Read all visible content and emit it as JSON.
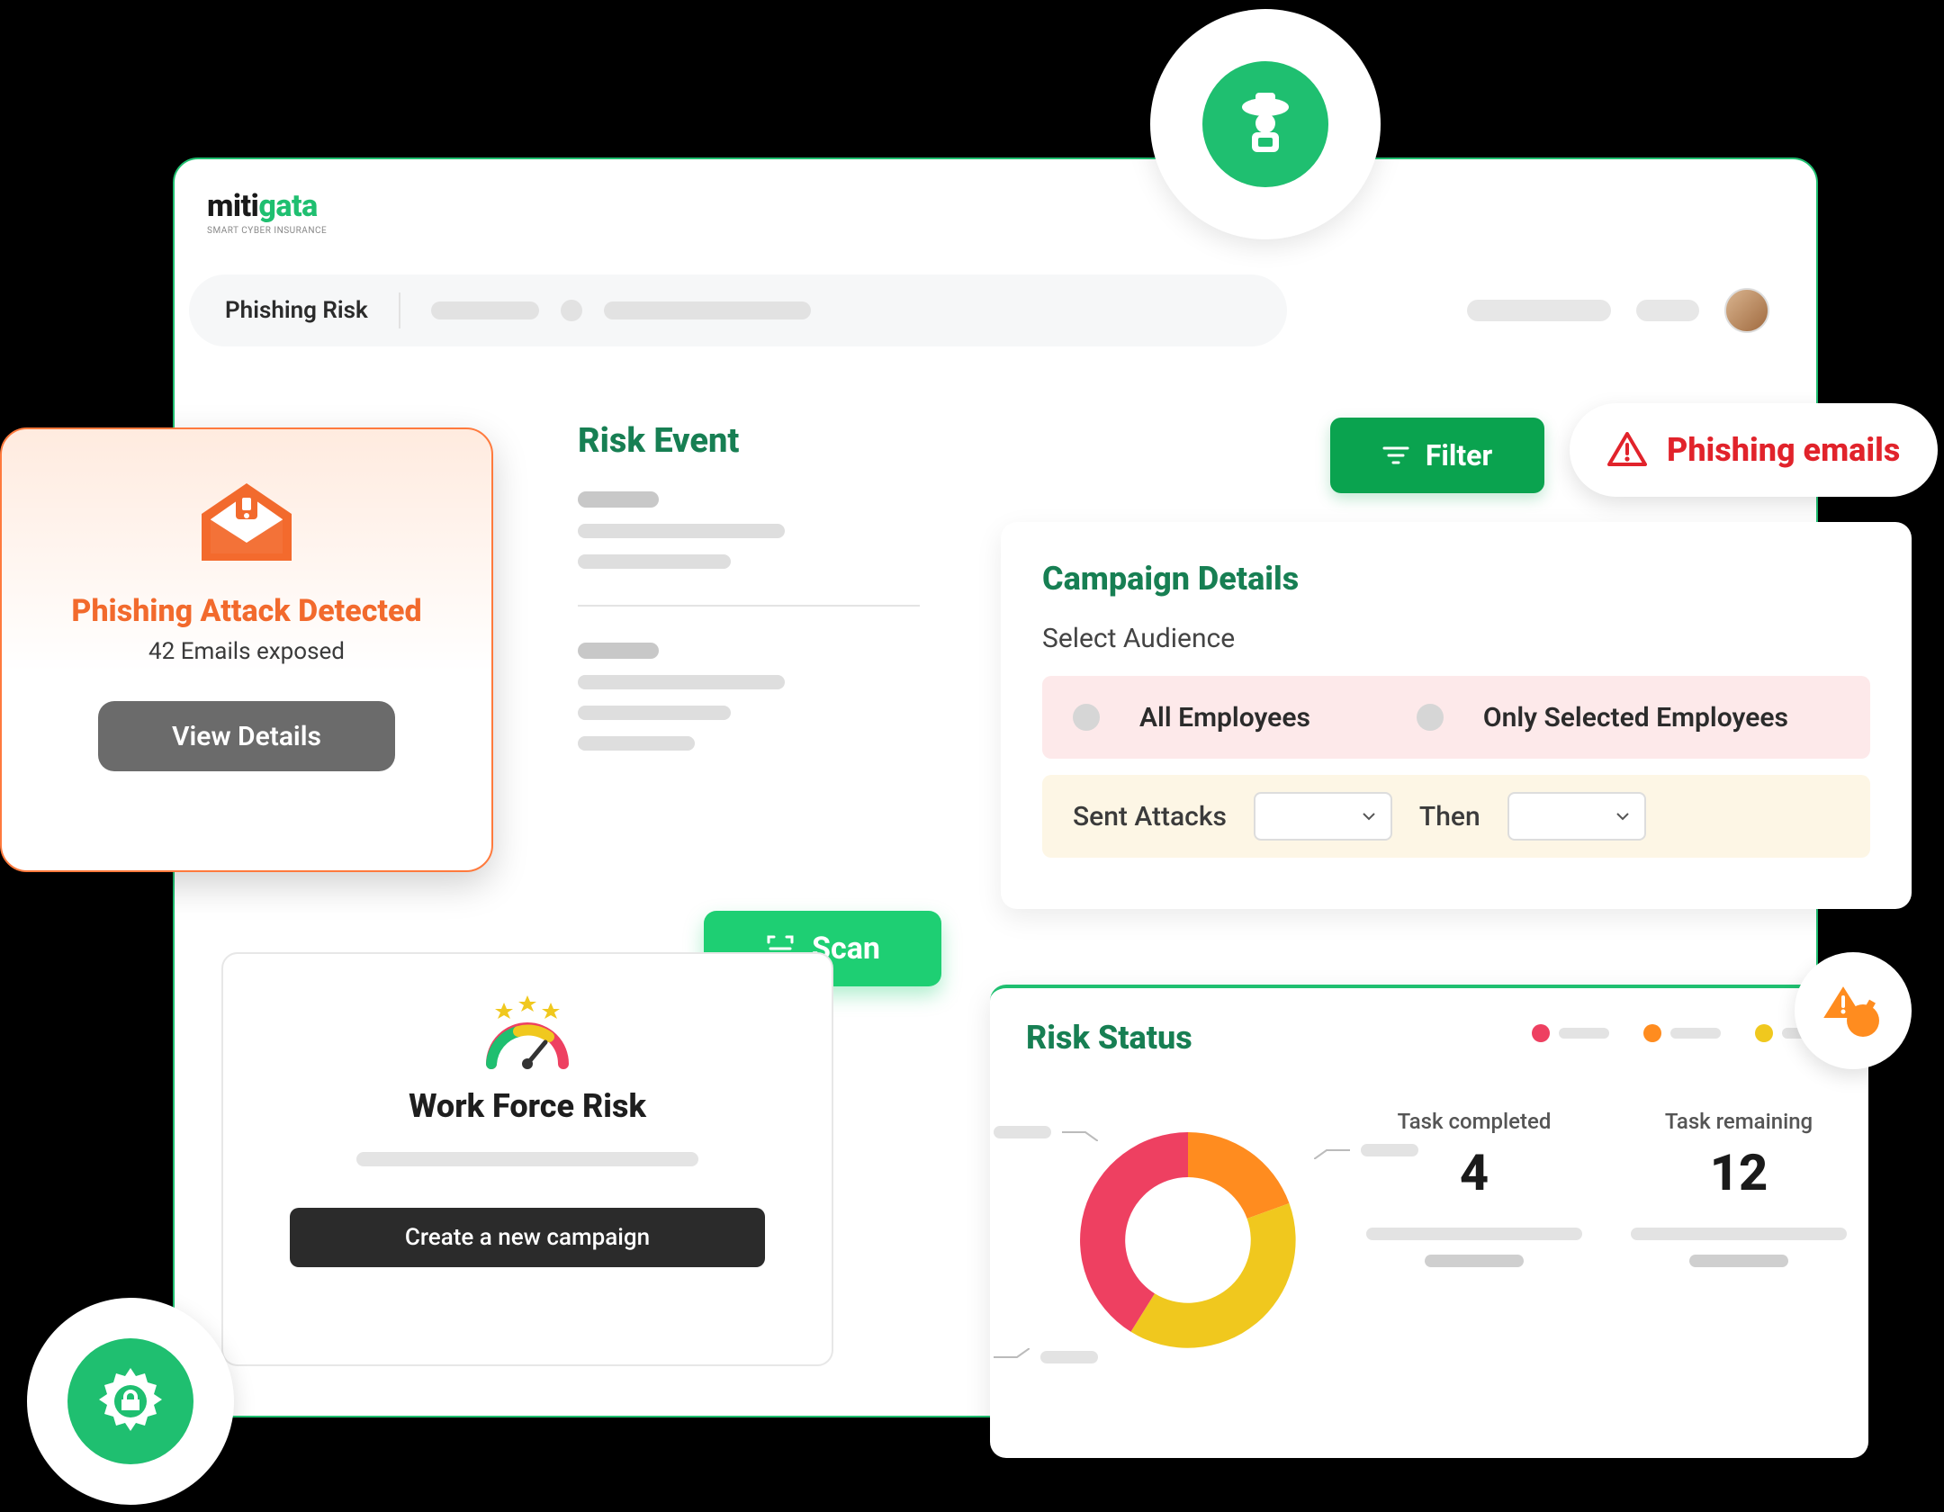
{
  "brand": {
    "name_left": "miti",
    "name_right": "gata",
    "tagline": "SMART CYBER INSURANCE"
  },
  "topbar": {
    "search_label": "Phishing Risk"
  },
  "filter": {
    "label": "Filter"
  },
  "warn_pill": {
    "label": "Phishing emails"
  },
  "phish_alert": {
    "title": "Phishing Attack Detected",
    "subtitle": "42 Emails exposed",
    "button": "View Details"
  },
  "risk_event": {
    "title": "Risk Event"
  },
  "campaign": {
    "title": "Campaign Details",
    "select_label": "Select Audience",
    "option_all": "All Employees",
    "option_selected": "Only Selected Employees",
    "sent_label": "Sent Attacks",
    "then_label": "Then"
  },
  "scan": {
    "label": "Scan"
  },
  "wfr": {
    "title": "Work Force Risk",
    "button": "Create a new campaign"
  },
  "risk_status": {
    "title": "Risk Status",
    "task_completed_label": "Task completed",
    "task_completed_value": "4",
    "task_remaining_label": "Task remaining",
    "task_remaining_value": "12",
    "legend_colors": [
      "#ee4061",
      "#ff8c1f",
      "#f0c81e"
    ]
  },
  "chart_data": {
    "type": "pie",
    "title": "Risk Status",
    "series": [
      {
        "name": "red",
        "value": 40,
        "color": "#ee4061"
      },
      {
        "name": "orange",
        "value": 25,
        "color": "#ff8c1f"
      },
      {
        "name": "yellow",
        "value": 35,
        "color": "#f0c81e"
      }
    ]
  }
}
